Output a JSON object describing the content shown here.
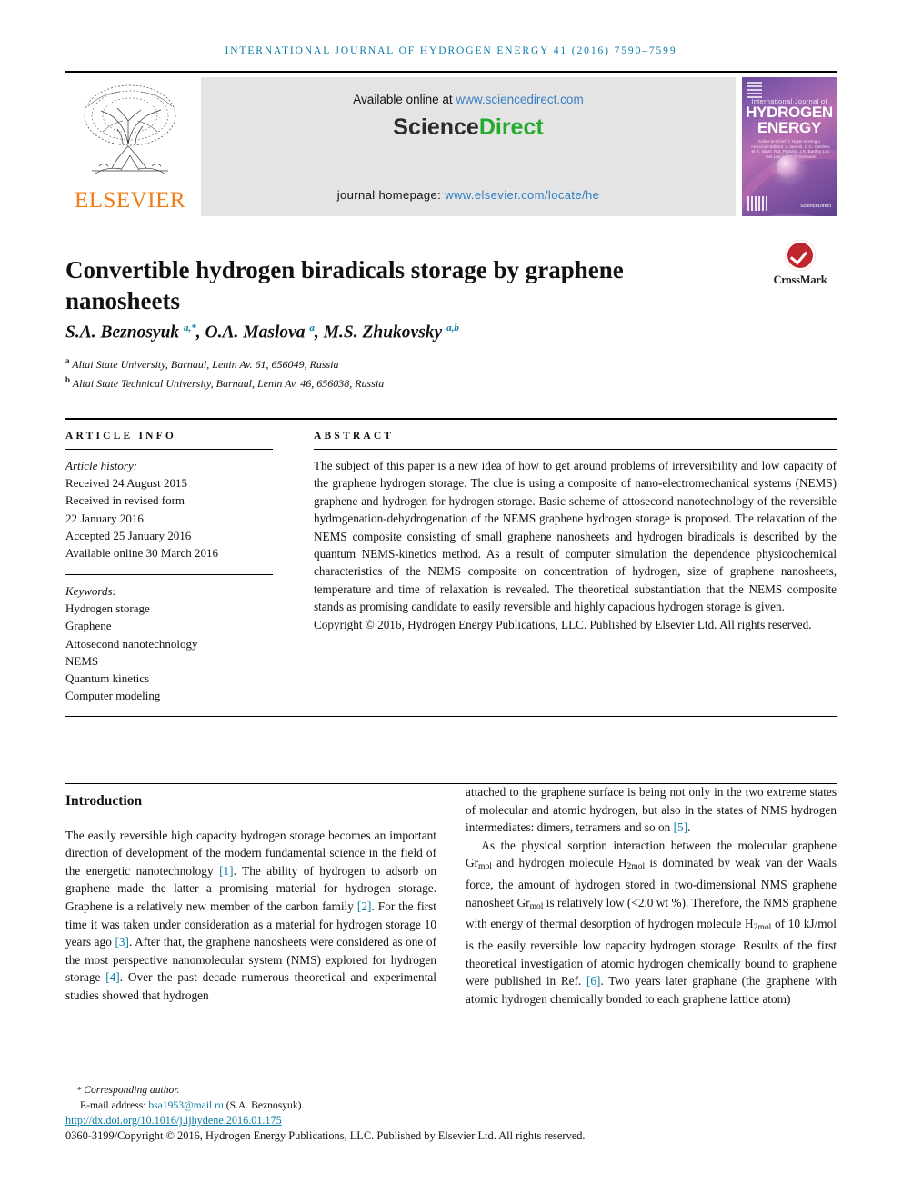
{
  "running_head": "International Journal of Hydrogen Energy 41 (2016) 7590–7599",
  "masthead": {
    "publisher_word": "ELSEVIER",
    "available_prefix": "Available online at ",
    "available_link": "www.sciencedirect.com",
    "sciencedirect_science": "Science",
    "sciencedirect_direct": "Direct",
    "homepage_label": "journal homepage: ",
    "homepage_link": "www.elsevier.com/locate/he",
    "cover": {
      "line1": "International Journal of",
      "line2": "HYDROGEN",
      "line3": "ENERGY",
      "editors": "Editor-in-Chief: T. Nejat Veziroglu · Associate Editors: A. Bartok, D.C. Gardner, M.R. Islam, R.Z. Pancha, J.R. Bartley, Luc Van Loo and D.Y. Goswami",
      "sciencedirect_mark": "ScienceDirect"
    }
  },
  "crossmark": {
    "label": "CrossMark",
    "icon": "crossmark-check-icon",
    "color": "#c0272d"
  },
  "article": {
    "title": "Convertible hydrogen biradicals storage by graphene nanosheets",
    "authors_html": "S.A. Beznosyuk <sup>a,*</sup>, O.A. Maslova <sup>a</sup>, M.S. Zhukovsky <sup>a,b</sup>",
    "affiliations_html": "<sup>a</sup> Altai State University, Barnaul, Lenin Av. 61, 656049, Russia<br><sup>b</sup> Altai State Technical University, Barnaul, Lenin Av. 46, 656038, Russia"
  },
  "info": {
    "header": "ARTICLE INFO",
    "history_label": "Article history:",
    "history": [
      "Received 24 August 2015",
      "Received in revised form",
      "22 January 2016",
      "Accepted 25 January 2016",
      "Available online 30 March 2016"
    ],
    "keywords_label": "Keywords:",
    "keywords": [
      "Hydrogen storage",
      "Graphene",
      "Attosecond nanotechnology",
      "NEMS",
      "Quantum kinetics",
      "Computer modeling"
    ]
  },
  "abstract": {
    "header": "ABSTRACT",
    "body": "The subject of this paper is a new idea of how to get around problems of irreversibility and low capacity of the graphene hydrogen storage. The clue is using a composite of nano-electromechanical systems (NEMS) graphene and hydrogen for hydrogen storage. Basic scheme of attosecond nanotechnology of the reversible hydrogenation-dehydrogenation of the NEMS graphene hydrogen storage is proposed. The relaxation of the NEMS composite consisting of small graphene nanosheets and hydrogen biradicals is described by the quantum NEMS-kinetics method. As a result of computer simulation the dependence physicochemical characteristics of the NEMS composite on concentration of hydrogen, size of graphene nanosheets, temperature and time of relaxation is revealed. The theoretical substantiation that the NEMS composite stands as promising candidate to easily reversible and highly capacious hydrogen storage is given.",
    "copyright": "Copyright © 2016, Hydrogen Energy Publications, LLC. Published by Elsevier Ltd. All rights reserved."
  },
  "body": {
    "section_title": "Introduction",
    "left_html": "The easily reversible high capacity hydrogen storage becomes an important direction of development of the modern fundamental science in the field of the energetic nanotechnology <a class=\"cite\" href=\"#\">[1]</a>. The ability of hydrogen to adsorb on graphene made the latter a promising material for hydrogen storage. Graphene is a relatively new member of the carbon family <a class=\"cite\" href=\"#\">[2]</a>. For the first time it was taken under consideration as a material for hydrogen storage 10 years ago <a class=\"cite\" href=\"#\">[3]</a>. After that, the graphene nanosheets were considered as one of the most perspective nanomolecular system (NMS) explored for hydrogen storage <a class=\"cite\" href=\"#\">[4]</a>. Over the past decade numerous theoretical and experimental studies showed that hydrogen",
    "right_p1_html": "attached to the graphene surface is being not only in the two extreme states of molecular and atomic hydrogen, but also in the states of NMS hydrogen intermediates: dimers, tetramers and so on <a class=\"cite\" href=\"#\">[5]</a>.",
    "right_p2_html": "As the physical sorption interaction between the molecular graphene Gr<sub>mol</sub> and hydrogen molecule H<sub>2mol</sub> is dominated by weak van der Waals force, the amount of hydrogen stored in two-dimensional NMS graphene nanosheet Gr<sub>mol</sub> is relatively low (&lt;2.0 wt %). Therefore, the NMS graphene with energy of thermal desorption of hydrogen molecule H<sub>2mol</sub> of 10 kJ/mol is the easily reversible low capacity hydrogen storage. Results of the first theoretical investigation of atomic hydrogen chemically bound to graphene were published in Ref. <a class=\"cite\" href=\"#\">[6]</a>. Two years later graphane (the graphene with atomic hydrogen chemically bonded to each graphene lattice atom)"
  },
  "footer": {
    "corresponding": "Corresponding author.",
    "email_label": "E-mail address: ",
    "email": "bsa1953@mail.ru",
    "email_suffix": " (S.A. Beznosyuk).",
    "doi": "http://dx.doi.org/10.1016/j.ijhydene.2016.01.175",
    "issn_line": "0360-3199/Copyright © 2016, Hydrogen Energy Publications, LLC. Published by Elsevier Ltd. All rights reserved."
  }
}
